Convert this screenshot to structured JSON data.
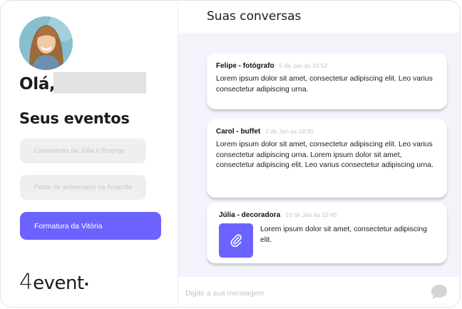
{
  "sidebar": {
    "greeting": "Olá,",
    "events_title": "Seus eventos",
    "events": [
      {
        "label": "Casamento da Júlia e Rodrigo",
        "active": false
      },
      {
        "label": "Festa de aniversário da Amanda",
        "active": false
      },
      {
        "label": "Formatura da Vitória",
        "active": true
      }
    ],
    "logo": {
      "prefix": "4",
      "word": "event"
    }
  },
  "main": {
    "title": "Suas conversas",
    "messages": [
      {
        "sender": "Felipe - fotógrafo",
        "time": "5 de Jan às 14:52",
        "text": "Lorem ipsum dolor sit amet, consectetur adipiscing elit. Leo varius consectetur adipiscing urna."
      },
      {
        "sender": "Carol - buffet",
        "time": "7 de Jan às 19:30",
        "text": "Lorem ipsum dolor sit amet, consectetur adipiscing elit. Leo varius consectetur adipiscing urna. Lorem ipsum dolor sit amet, consectetur adipiscing elit. Leo varius consectetur adipiscing urna."
      },
      {
        "sender": "Júlia - decoradora",
        "time": "10 de Jan às 10:45",
        "text": "Lorem ipsum dolor sit amet, consectetur adipiscing elit.",
        "attachment_icon": "paperclip-icon"
      }
    ],
    "input": {
      "placeholder": "Digite a sua mensagem",
      "value": ""
    },
    "send_icon": "chat-bubble-icon"
  },
  "colors": {
    "accent": "#6c63ff",
    "chat_background": "#f3f3fc",
    "inactive_button": "#efefef",
    "inactive_text": "#c8c8c8",
    "timestamp": "#c5c5c5",
    "send_icon": "#d4d4d4"
  }
}
